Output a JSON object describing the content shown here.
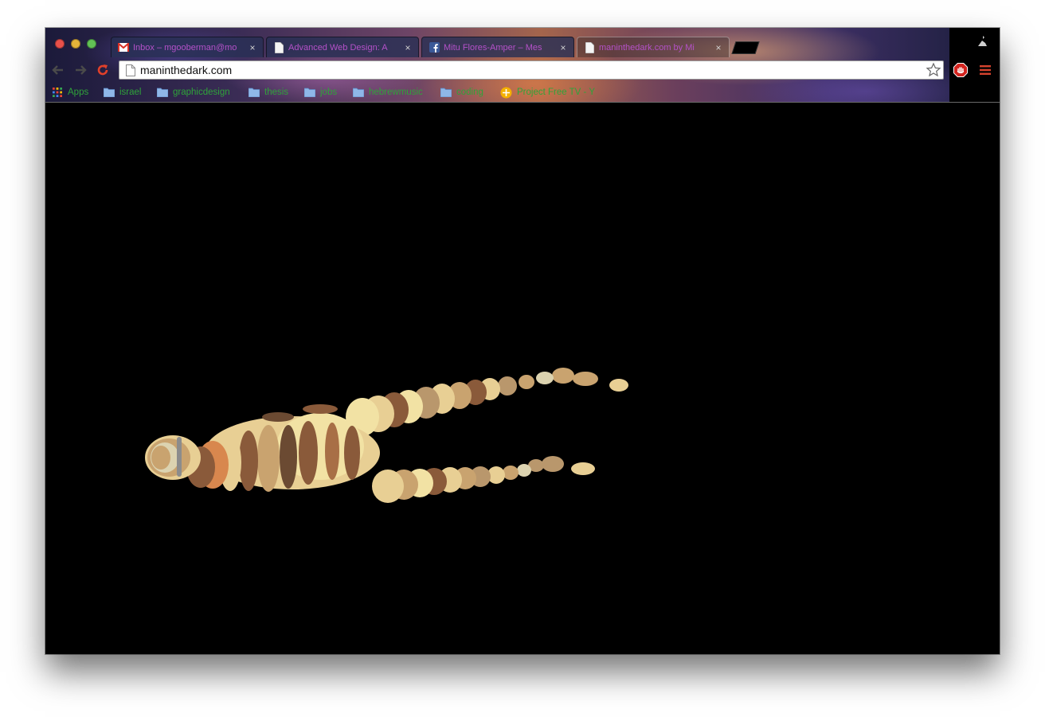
{
  "browser": {
    "tabs": [
      {
        "title": "Inbox – mgooberman@mo",
        "favicon": "gmail-icon"
      },
      {
        "title": "Advanced Web Design: A",
        "favicon": "page-icon"
      },
      {
        "title": "Mitu Flores-Amper – Mes",
        "favicon": "facebook-icon"
      },
      {
        "title": "maninthedark.com by Mi",
        "favicon": "page-icon",
        "active": true
      }
    ],
    "close_glyph": "×",
    "address": "maninthedark.com",
    "bookmarks": [
      {
        "label": "Apps",
        "icon": "apps-grid-icon"
      },
      {
        "label": "israel",
        "icon": "folder-icon"
      },
      {
        "label": "graphicdesign",
        "icon": "folder-icon"
      },
      {
        "label": "thesis",
        "icon": "folder-icon"
      },
      {
        "label": "jobs",
        "icon": "folder-icon"
      },
      {
        "label": "hebrewmusic",
        "icon": "folder-icon"
      },
      {
        "label": "coding",
        "icon": "folder-icon"
      },
      {
        "label": "Project Free TV - Y",
        "icon": "pftv-icon"
      }
    ]
  },
  "colors": {
    "tab_text": "#b451c8",
    "bookmark_text": "#2fa33a",
    "page_background": "#000000",
    "figure_palette": [
      "#f2e2a4",
      "#e8cf94",
      "#c9a36f",
      "#8a5a3a",
      "#6b4a32",
      "#d8874e",
      "#a86f46",
      "#dcd3b0",
      "#b9976c"
    ]
  }
}
